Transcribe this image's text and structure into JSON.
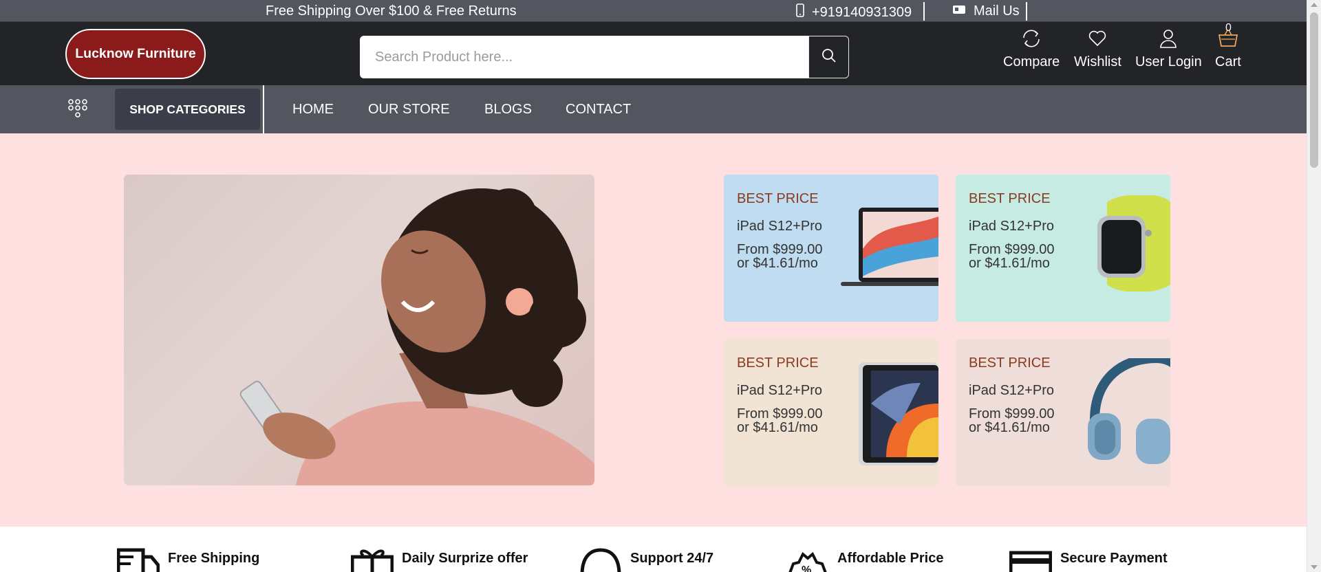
{
  "topbar": {
    "promo": "Free Shipping Over $100 & Free Returns",
    "phone": "+919140931309",
    "mail": "Mail Us",
    "phone_icon": "mobile-phone-icon",
    "mail_icon": "envelope-icon"
  },
  "header": {
    "logo": "Lucknow Furniture",
    "search_placeholder": "Search Product here...",
    "search_icon": "search-icon",
    "compare": "Compare",
    "wishlist": "Wishlist",
    "login": "User Login",
    "cart": "Cart",
    "cart_count": "0"
  },
  "nav": {
    "shop_categories": "SHOP CATEGORIES",
    "links": [
      "HOME",
      "OUR STORE",
      "BLOGS",
      "CONTACT"
    ]
  },
  "hero": {
    "cards": [
      {
        "tag": "BEST PRICE",
        "name": "iPad S12+Pro",
        "price_line1": "From $999.00",
        "price_line2": "or $41.61/mo",
        "image": "laptop",
        "bg": "#bfdcf0"
      },
      {
        "tag": "BEST PRICE",
        "name": "iPad S12+Pro",
        "price_line1": "From $999.00",
        "price_line2": "or $41.61/mo",
        "image": "smartwatch",
        "bg": "#c5ebe2"
      },
      {
        "tag": "BEST PRICE",
        "name": "iPad S12+Pro",
        "price_line1": "From $999.00",
        "price_line2": "or $41.61/mo",
        "image": "tablet",
        "bg": "#f1e4d5"
      },
      {
        "tag": "BEST PRICE",
        "name": "iPad S12+Pro",
        "price_line1": "From $999.00",
        "price_line2": "or $41.61/mo",
        "image": "headphones",
        "bg": "#eeddd9"
      }
    ],
    "accent": "#8b3a1f",
    "background": "#ffe0e0"
  },
  "services": [
    {
      "title": "Free Shipping",
      "icon": "delivery-truck-icon"
    },
    {
      "title": "Daily Surprize offer",
      "icon": "gift-icon"
    },
    {
      "title": "Support 24/7",
      "icon": "headset-icon"
    },
    {
      "title": "Affordable Price",
      "icon": "discount-badge-icon"
    },
    {
      "title": "Secure Payment",
      "icon": "credit-card-icon"
    }
  ],
  "colors": {
    "topbar": "#53555f",
    "header": "#232428",
    "logo": "#8b1a1a",
    "cart_accent": "#f2a65a"
  }
}
